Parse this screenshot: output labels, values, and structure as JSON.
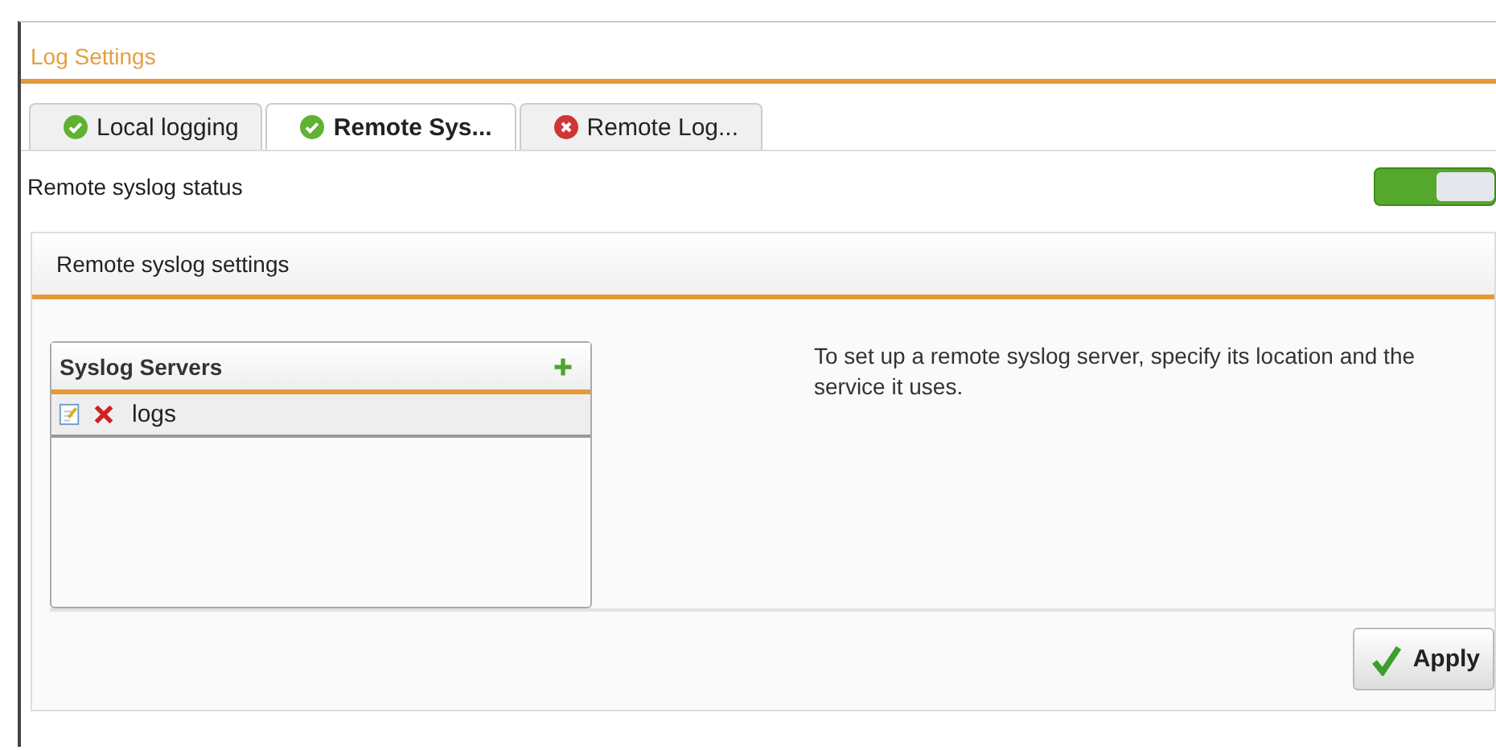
{
  "section": {
    "title": "Log Settings"
  },
  "tabs": [
    {
      "label": "Local logging",
      "kind": "ok",
      "selected": false
    },
    {
      "label": "Remote Sys...",
      "kind": "ok",
      "selected": true
    },
    {
      "label": "Remote Log...",
      "kind": "error",
      "selected": false
    }
  ],
  "status_row": {
    "label": "Remote syslog status",
    "on": true
  },
  "panel": {
    "title": "Remote syslog settings",
    "servers": {
      "title": "Syslog Servers",
      "items": [
        {
          "name": "logs",
          "selected": true
        }
      ]
    },
    "help": "To set up a remote syslog server, specify its location and the service it uses."
  },
  "buttons": [
    {
      "label": "Apply"
    }
  ]
}
